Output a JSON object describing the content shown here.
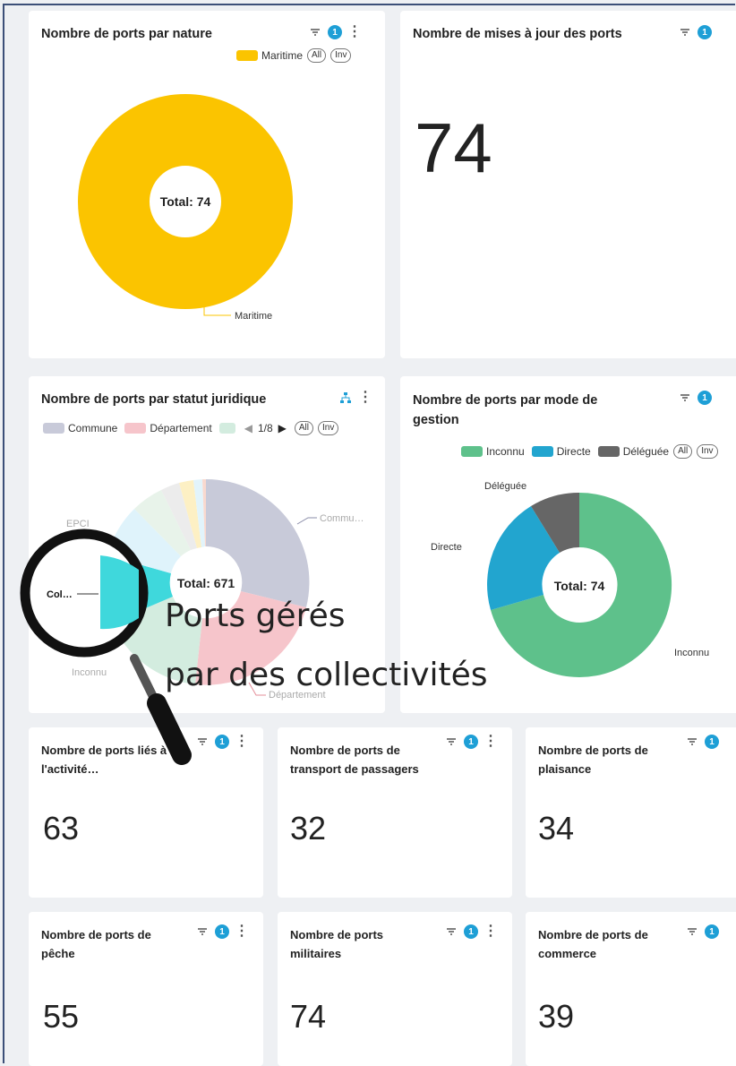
{
  "cards": {
    "nature": {
      "title": "Nombre de ports par nature",
      "badge": "1",
      "legend": [
        {
          "label": "Maritime",
          "color": "#fbc400"
        }
      ],
      "legend_all": "All",
      "legend_inv": "Inv",
      "center": "Total: 74",
      "slice_label": "Maritime"
    },
    "updates": {
      "title": "Nombre de mises à jour des ports",
      "badge": "1",
      "value": "74"
    },
    "statut": {
      "title": "Nombre de ports par statut juridique",
      "legend": [
        {
          "label": "Commune",
          "color": "#c8cad9"
        },
        {
          "label": "Département",
          "color": "#f6c5cb"
        },
        {
          "label": "",
          "color": "#d3ecdf"
        }
      ],
      "pager": "1/8",
      "legend_all": "All",
      "legend_inv": "Inv",
      "center": "Total: 671",
      "labels": {
        "commune": "Commu…",
        "departement": "Département",
        "inconnu": "Inconnu",
        "epci": "EPCI",
        "col": "Col…"
      }
    },
    "gestion": {
      "title_line1": "Nombre de ports par mode de",
      "title_line2": "gestion",
      "badge": "1",
      "legend": [
        {
          "label": "Inconnu",
          "color": "#5ec18b"
        },
        {
          "label": "Directe",
          "color": "#22a5cf"
        },
        {
          "label": "Déléguée",
          "color": "#666666"
        }
      ],
      "legend_all": "All",
      "legend_inv": "Inv",
      "center": "Total: 74",
      "labels": {
        "deleguee": "Déléguée",
        "directe": "Directe",
        "inconnu": "Inconnu"
      }
    },
    "kpis": [
      {
        "title_line1": "Nombre de ports liés à",
        "title_line2": "l'activité…",
        "badge": "1",
        "value": "63"
      },
      {
        "title_line1": "Nombre de ports de",
        "title_line2": "transport de passagers",
        "badge": "1",
        "value": "32"
      },
      {
        "title_line1": "Nombre de ports de",
        "title_line2": "plaisance",
        "badge": "1",
        "value": "34"
      },
      {
        "title_line1": "Nombre de ports de",
        "title_line2": "pêche",
        "badge": "1",
        "value": "55"
      },
      {
        "title_line1": "Nombre de ports",
        "title_line2": "militaires",
        "badge": "1",
        "value": "74"
      },
      {
        "title_line1": "Nombre de ports de",
        "title_line2": "commerce",
        "badge": "1",
        "value": "39"
      }
    ]
  },
  "overlay": {
    "line1": "Ports gérés",
    "line2": "par des collectivités"
  },
  "chart_data": [
    {
      "type": "pie",
      "title": "Nombre de ports par nature",
      "categories": [
        "Maritime"
      ],
      "values": [
        74
      ],
      "total": 74
    },
    {
      "type": "pie",
      "title": "Nombre de ports par mode de gestion",
      "categories": [
        "Inconnu",
        "Directe",
        "Déléguée"
      ],
      "values": [
        50,
        15,
        9
      ],
      "total": 74
    },
    {
      "type": "pie",
      "title": "Nombre de ports par statut juridique",
      "categories": [
        "Commune",
        "Département",
        "Inconnu",
        "Col…",
        "EPCI"
      ],
      "values": [
        190,
        120,
        70,
        55,
        40
      ],
      "total": 671
    }
  ]
}
